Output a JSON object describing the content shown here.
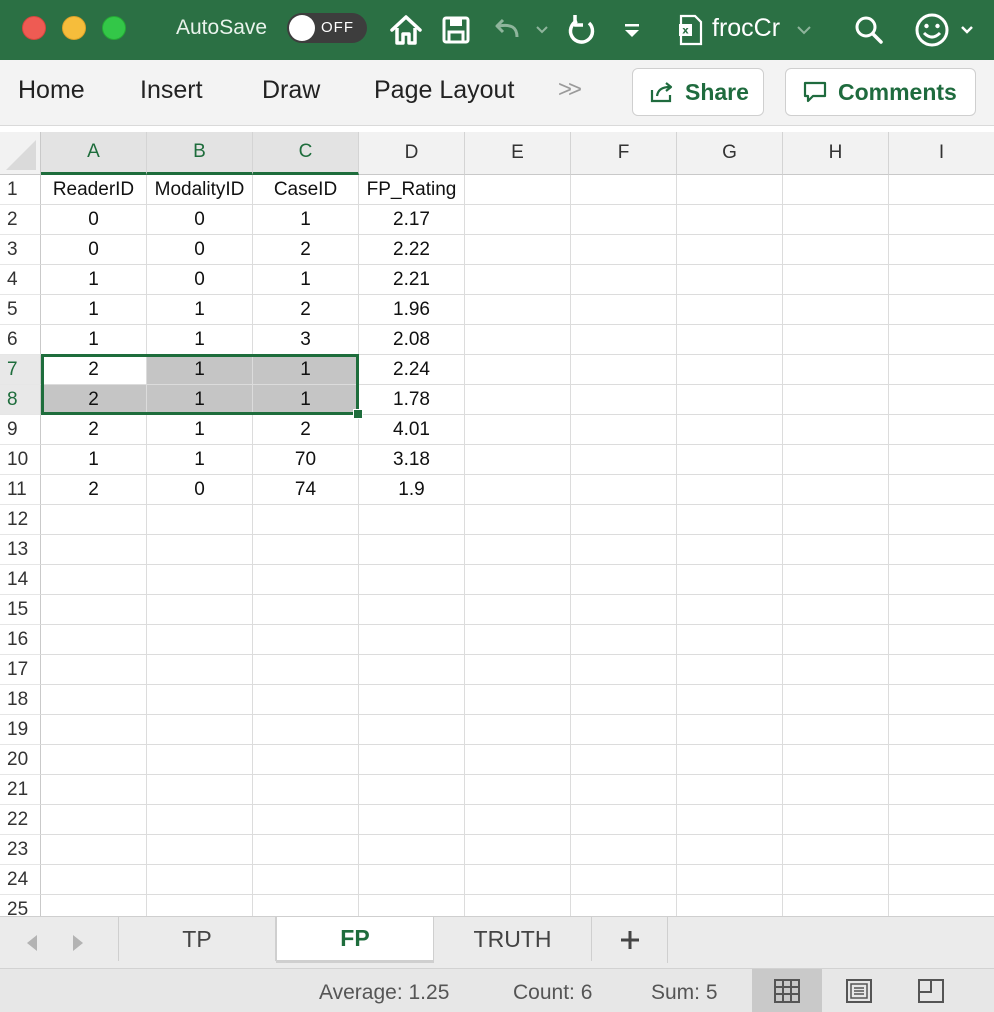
{
  "titlebar": {
    "autosave_label": "AutoSave",
    "autosave_state": "OFF",
    "document_title": "frocCr",
    "icons": [
      "home-icon",
      "save-icon",
      "undo-icon",
      "redo-icon",
      "customize-toolbar-icon",
      "excel-file-icon",
      "search-icon",
      "smiley-feedback-icon"
    ]
  },
  "ribbon": {
    "tabs": [
      "Home",
      "Insert",
      "Draw",
      "Page Layout"
    ],
    "more": ">>",
    "share_label": "Share",
    "comments_label": "Comments"
  },
  "grid": {
    "columns": [
      "A",
      "B",
      "C",
      "D",
      "E",
      "F",
      "G",
      "H",
      "I"
    ],
    "selected_columns": [
      "A",
      "B",
      "C"
    ],
    "row_numbers": [
      "1",
      "2",
      "3",
      "4",
      "5",
      "6",
      "7",
      "8",
      "9",
      "10",
      "11",
      "12",
      "13",
      "14",
      "15",
      "16",
      "17",
      "18",
      "19",
      "20",
      "21",
      "22",
      "23",
      "24",
      "25"
    ],
    "selected_rows": [
      "7",
      "8"
    ],
    "headers": [
      "ReaderID",
      "ModalityID",
      "CaseID",
      "FP_Rating"
    ],
    "rows": [
      [
        "0",
        "0",
        "1",
        "2.17"
      ],
      [
        "0",
        "0",
        "2",
        "2.22"
      ],
      [
        "1",
        "0",
        "1",
        "2.21"
      ],
      [
        "1",
        "1",
        "2",
        "1.96"
      ],
      [
        "1",
        "1",
        "3",
        "2.08"
      ],
      [
        "2",
        "1",
        "1",
        "2.24"
      ],
      [
        "2",
        "1",
        "1",
        "1.78"
      ],
      [
        "2",
        "1",
        "2",
        "4.01"
      ],
      [
        "1",
        "1",
        "70",
        "3.18"
      ],
      [
        "2",
        "0",
        "74",
        "1.9"
      ]
    ],
    "selection": "A7:C8"
  },
  "sheets": {
    "tabs": [
      "TP",
      "FP",
      "TRUTH"
    ],
    "active": "FP",
    "add_label": "+"
  },
  "status": {
    "average": "Average: 1.25",
    "count": "Count: 6",
    "sum": "Sum: 5"
  },
  "colors": {
    "title_bar": "#2b7044",
    "accent": "#1e6d3c",
    "selection_fill": "#c5c5c5"
  }
}
